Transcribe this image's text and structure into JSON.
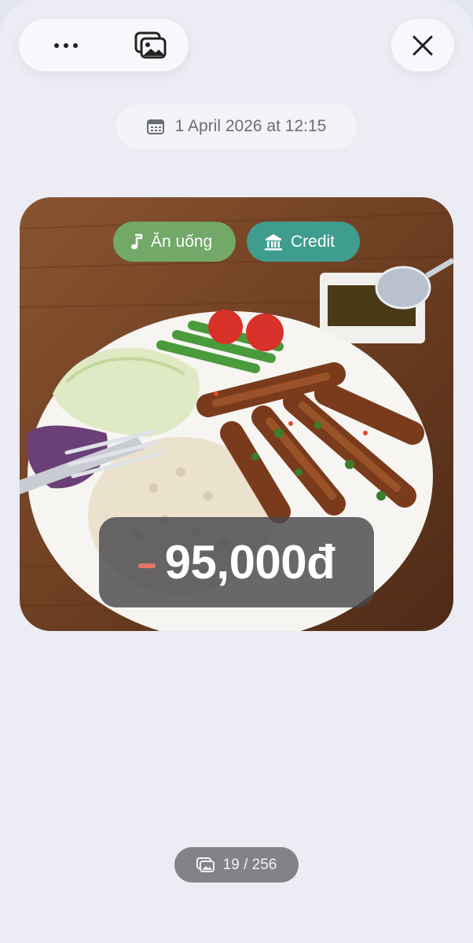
{
  "toolbar": {
    "more_icon": "ellipsis-icon",
    "gallery_icon": "photo-stack-icon",
    "close_icon": "close-icon"
  },
  "date": {
    "icon": "calendar-icon",
    "text": "1 April 2026 at 12:15"
  },
  "tags": {
    "category": {
      "icon": "music-note-icon",
      "label": "Ăn uống",
      "color": "#72a868"
    },
    "account": {
      "icon": "bank-icon",
      "label": "Credit",
      "color": "#3f9d8f"
    }
  },
  "transaction": {
    "amount": "95,000đ",
    "sign_color": "#e5756b"
  },
  "counter": {
    "icon": "photo-stack-icon",
    "text": "19 / 256"
  }
}
